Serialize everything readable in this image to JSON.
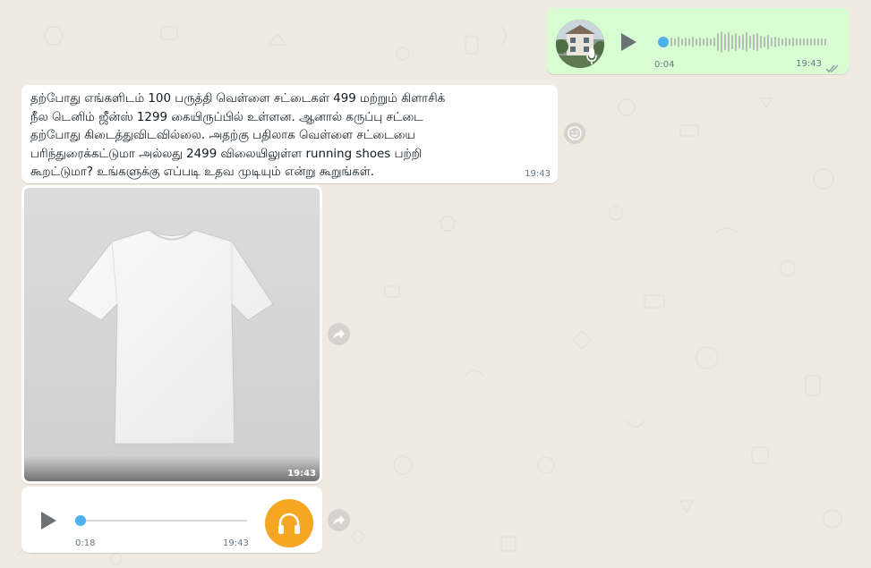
{
  "colors": {
    "outgoing_bubble": "#d9fdd3",
    "incoming_bubble": "#ffffff",
    "chat_background": "#efeae2",
    "progress_dot": "#4fb1ec",
    "headphone_badge": "#f5a623"
  },
  "outgoing_voice": {
    "duration": "0:04",
    "time": "19:43",
    "status_icon": "double-check-icon",
    "avatar_icon": "profile-photo",
    "progress": 0
  },
  "incoming_text": {
    "text": "தற்போது எங்களிடம் 100 பருத்தி வெள்ளை சட்டைகள் 499 மற்றும் கிளாசிக்\nநீல டெனிம் ஜீன்ஸ் 1299 கையிருப்பில் உள்ளன. ஆனால் கருப்பு சட்டை\nதற்போது கிடைத்துவிடவில்லை. அதற்கு பதிலாக வெள்ளை சட்டையை\nபரிந்துரைக்கட்டுமா அல்லது 2499 விலையிலுள்ள running shoes பற்றி\nகூறட்டுமா? உங்களுக்கு எப்படி உதவ முடியும் என்று கூறுங்கள்.",
    "time": "19:43"
  },
  "incoming_image": {
    "time": "19:43",
    "subject": "white-tshirt"
  },
  "incoming_audio": {
    "duration": "0:18",
    "time": "19:43",
    "badge_icon": "headphones-icon",
    "progress": 0
  }
}
